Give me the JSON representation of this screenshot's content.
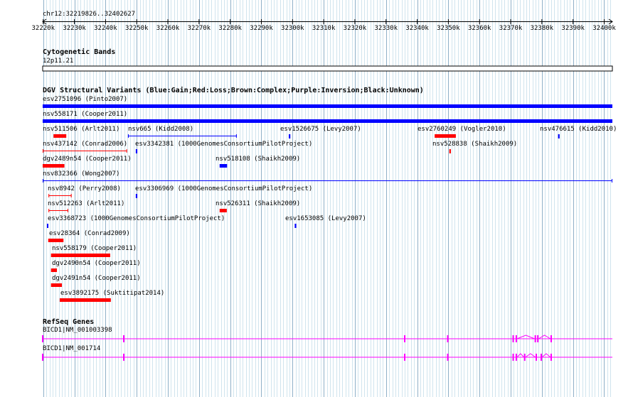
{
  "region_label": "chr12:32219826..32402627",
  "ruler_ticks": [
    "32220k",
    "32230k",
    "32240k",
    "32250k",
    "32260k",
    "32270k",
    "32280k",
    "32290k",
    "32300k",
    "32310k",
    "32320k",
    "32330k",
    "32340k",
    "32350k",
    "32360k",
    "32370k",
    "32380k",
    "32390k",
    "32400k"
  ],
  "cytoband": {
    "title": "Cytogenetic Bands",
    "band": "12p11.21"
  },
  "dgv": {
    "title": "DGV Structural Variants (Blue:Gain;Red:Loss;Brown:Complex;Purple:Inversion;Black:Unknown)",
    "colors": {
      "gain": "#0000ff",
      "loss": "#ff0000",
      "unknown": "#000000"
    },
    "variants": [
      {
        "label": "esv2751096 (Pinto2007)",
        "type": "gain",
        "style": "bar",
        "start": 32219826,
        "end": 32402627
      },
      {
        "label": "nsv558171 (Cooper2011)",
        "type": "gain",
        "style": "bar",
        "start": 32219826,
        "end": 32402627
      },
      {
        "label": "nsv511506 (Arlt2011)",
        "type": "loss",
        "style": "bar",
        "start": 32223300,
        "end": 32227400
      },
      {
        "label": "nsv665 (Kidd2008)",
        "type": "gain",
        "style": "span",
        "start": 32247200,
        "end": 32282100
      },
      {
        "label": "esv1526675 (Levy2007)",
        "type": "gain",
        "style": "tick",
        "start": 32298800,
        "end": 32299300
      },
      {
        "label": "esv2760249 (Vogler2010)",
        "type": "loss",
        "style": "bar",
        "start": 32345600,
        "end": 32352400
      },
      {
        "label": "nsv476615 (Kidd2010)",
        "type": "gain",
        "style": "tick",
        "start": 32385200,
        "end": 32385700
      },
      {
        "label": "nsv437142 (Conrad2006)",
        "type": "loss",
        "style": "span",
        "start": 32219826,
        "end": 32246900
      },
      {
        "label": "esv3342381 (1000GenomesConsortiumPilotProject)",
        "type": "gain",
        "style": "tick",
        "start": 32249700,
        "end": 32250200
      },
      {
        "label": "nsv528838 (Shaikh2009)",
        "type": "loss",
        "style": "tick",
        "start": 32350300,
        "end": 32350800
      },
      {
        "label": "dgv2489n54 (Cooper2011)",
        "type": "loss",
        "style": "bar",
        "start": 32219826,
        "end": 32226800
      },
      {
        "label": "nsv518108 (Shaikh2009)",
        "type": "gain",
        "style": "bar",
        "start": 32276600,
        "end": 32279000
      },
      {
        "label": "nsv832366 (Wong2007)",
        "type": "gain",
        "style": "span",
        "start": 32219826,
        "end": 32402627
      },
      {
        "label": "nsv8942 (Perry2008)",
        "type": "loss",
        "style": "span",
        "start": 32221700,
        "end": 32229100
      },
      {
        "label": "esv3306969 (1000GenomesConsortiumPilotProject)",
        "type": "gain",
        "style": "tick",
        "start": 32249700,
        "end": 32250200
      },
      {
        "label": "nsv512263 (Arlt2011)",
        "type": "loss",
        "style": "span",
        "start": 32221700,
        "end": 32228000
      },
      {
        "label": "nsv526311 (Shaikh2009)",
        "type": "loss",
        "style": "bar",
        "start": 32276600,
        "end": 32278900
      },
      {
        "label": "esv3368723 (1000GenomesConsortiumPilotProject)",
        "type": "gain",
        "style": "tick",
        "start": 32221200,
        "end": 32221600
      },
      {
        "label": "esv1653085 (Levy2007)",
        "type": "gain",
        "style": "tick",
        "start": 32300700,
        "end": 32301200
      },
      {
        "label": "esv28364 (Conrad2009)",
        "type": "loss",
        "style": "bar",
        "start": 32221600,
        "end": 32226500
      },
      {
        "label": "nsv558179 (Cooper2011)",
        "type": "loss",
        "style": "bar",
        "start": 32222500,
        "end": 32241500
      },
      {
        "label": "dgv2490n54 (Cooper2011)",
        "type": "loss",
        "style": "bar",
        "start": 32222500,
        "end": 32224400
      },
      {
        "label": "dgv2491n54 (Cooper2011)",
        "type": "loss",
        "style": "bar",
        "start": 32222500,
        "end": 32226000
      },
      {
        "label": "esv3892175 (Suktitipat2014)",
        "type": "loss",
        "style": "bar",
        "start": 32225300,
        "end": 32241700
      }
    ]
  },
  "refseq": {
    "title": "RefSeq Genes",
    "color": "#ff00ff",
    "genes": [
      {
        "label": "BICD1|NM_001003398",
        "exons": [
          32219826,
          32245850,
          32336000,
          32349800,
          32370800,
          32371800,
          32377900,
          32378700,
          32383000
        ]
      },
      {
        "label": "BICD1|NM_001714",
        "exons": [
          32219826,
          32245850,
          32336000,
          32349800,
          32370800,
          32371800,
          32374500,
          32378200,
          32379800,
          32383000
        ]
      }
    ]
  }
}
